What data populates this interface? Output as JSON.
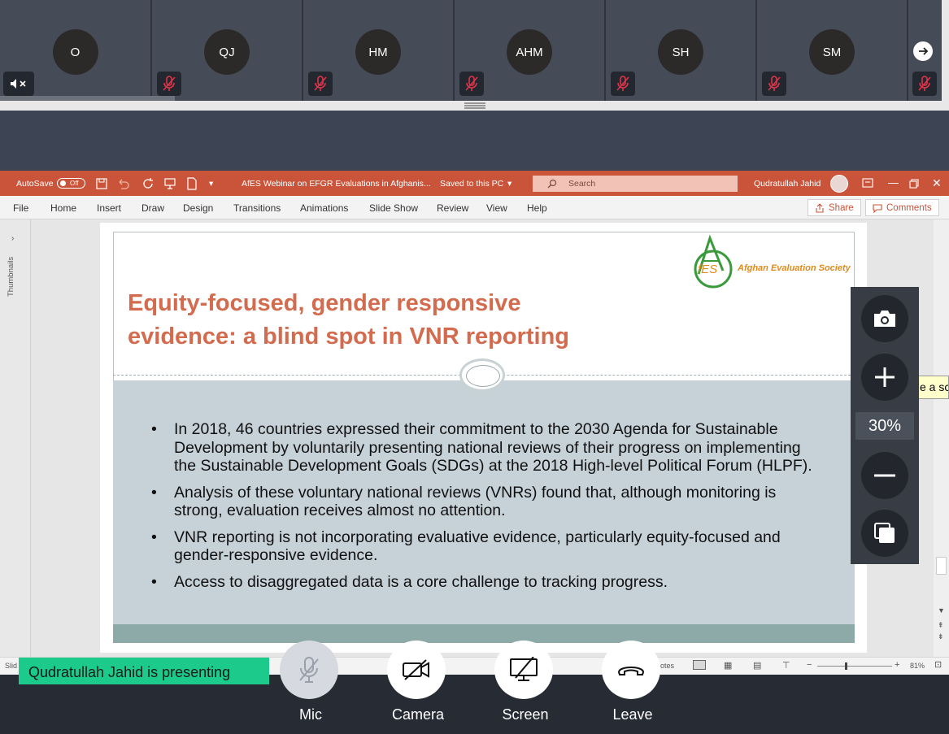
{
  "participants": [
    {
      "initials": "O",
      "status": "speaker-muted"
    },
    {
      "initials": "QJ",
      "status": "mic-muted"
    },
    {
      "initials": "HM",
      "status": "mic-muted"
    },
    {
      "initials": "AHM",
      "status": "mic-muted"
    },
    {
      "initials": "SH",
      "status": "mic-muted"
    },
    {
      "initials": "SM",
      "status": "mic-muted"
    }
  ],
  "ppt": {
    "autosave_label": "AutoSave",
    "autosave_state": "Off",
    "doc_title": "AfES Webinar on EFGR Evaluations in Afghanis...",
    "save_state": "Saved to this PC",
    "search_placeholder": "Search",
    "user_name": "Qudratullah Jahid",
    "menu": [
      "File",
      "Home",
      "Insert",
      "Draw",
      "Design",
      "Transitions",
      "Animations",
      "Slide Show",
      "Review",
      "View",
      "Help"
    ],
    "share_label": "Share",
    "comments_label": "Comments",
    "thumbnails_label": "Thumbnails",
    "status_left": "Slid",
    "status_notes": "otes",
    "status_zoom_pct": "81%"
  },
  "slide": {
    "title_line1": "Equity-focused, gender responsive",
    "title_line2": "evidence: a blind spot in VNR reporting",
    "logo_mark": "fES",
    "logo_text": "Afghan Evaluation Society",
    "bullets": [
      "In 2018, 46 countries expressed their commitment to the 2030 Agenda for Sustainable Development by voluntarily presenting national reviews of their progress on implementing the Sustainable Development Goals (SDGs) at the 2018 High-level Political Forum (HLPF).",
      "Analysis of these voluntary national reviews (VNRs) found that, although monitoring is strong, evaluation receives almost no attention.",
      "VNR reporting is not incorporating evaluative evidence, particularly equity-focused and gender-responsive evidence.",
      "Access to disaggregated data is a core challenge to tracking progress."
    ]
  },
  "zoom": {
    "level": "30%"
  },
  "tooltip": "e a scr",
  "presenting_banner": "Qudratullah Jahid is presenting",
  "controls": {
    "mic": "Mic",
    "camera": "Camera",
    "screen": "Screen",
    "leave": "Leave"
  },
  "colors": {
    "ppt_accent": "#c9543a",
    "title_orange": "#d36b4e",
    "presenting_green": "#1cca8c",
    "body_blue": "#c6d1d8"
  }
}
